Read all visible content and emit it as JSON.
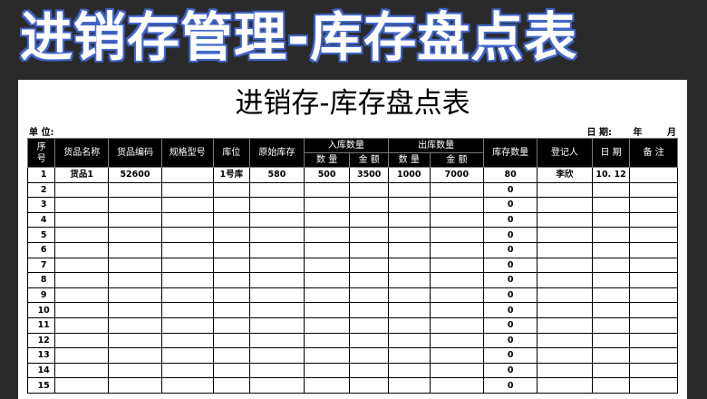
{
  "banner": {
    "title": "进销存管理-库存盘点表"
  },
  "sheet": {
    "title": "进销存-库存盘点表",
    "unit_label": "单 位:",
    "date_label": "日 期:",
    "year_label": "年",
    "month_label": "月"
  },
  "columns": {
    "seq": "序号",
    "name": "货品名称",
    "code": "货品编码",
    "spec": "规格型号",
    "location": "库位",
    "initial": "原始库存",
    "in_group": "入库数量",
    "in_qty": "数 量",
    "in_amount": "金 额",
    "out_group": "出库数量",
    "out_qty": "数 量",
    "out_amount": "金 额",
    "stock": "库存数量",
    "recorder": "登记人",
    "date": "日 期",
    "remark": "备 注"
  },
  "rows": [
    {
      "seq": "1",
      "name": "货品1",
      "code": "52600",
      "spec": "",
      "location": "1号库",
      "initial": "580",
      "in_qty": "500",
      "in_amount": "3500",
      "out_qty": "1000",
      "out_amount": "7000",
      "stock": "80",
      "recorder": "李欣",
      "date": "10. 12",
      "remark": ""
    },
    {
      "seq": "2",
      "name": "",
      "code": "",
      "spec": "",
      "location": "",
      "initial": "",
      "in_qty": "",
      "in_amount": "",
      "out_qty": "",
      "out_amount": "",
      "stock": "0",
      "recorder": "",
      "date": "",
      "remark": ""
    },
    {
      "seq": "3",
      "name": "",
      "code": "",
      "spec": "",
      "location": "",
      "initial": "",
      "in_qty": "",
      "in_amount": "",
      "out_qty": "",
      "out_amount": "",
      "stock": "0",
      "recorder": "",
      "date": "",
      "remark": ""
    },
    {
      "seq": "4",
      "name": "",
      "code": "",
      "spec": "",
      "location": "",
      "initial": "",
      "in_qty": "",
      "in_amount": "",
      "out_qty": "",
      "out_amount": "",
      "stock": "0",
      "recorder": "",
      "date": "",
      "remark": ""
    },
    {
      "seq": "5",
      "name": "",
      "code": "",
      "spec": "",
      "location": "",
      "initial": "",
      "in_qty": "",
      "in_amount": "",
      "out_qty": "",
      "out_amount": "",
      "stock": "0",
      "recorder": "",
      "date": "",
      "remark": ""
    },
    {
      "seq": "6",
      "name": "",
      "code": "",
      "spec": "",
      "location": "",
      "initial": "",
      "in_qty": "",
      "in_amount": "",
      "out_qty": "",
      "out_amount": "",
      "stock": "0",
      "recorder": "",
      "date": "",
      "remark": ""
    },
    {
      "seq": "7",
      "name": "",
      "code": "",
      "spec": "",
      "location": "",
      "initial": "",
      "in_qty": "",
      "in_amount": "",
      "out_qty": "",
      "out_amount": "",
      "stock": "0",
      "recorder": "",
      "date": "",
      "remark": ""
    },
    {
      "seq": "8",
      "name": "",
      "code": "",
      "spec": "",
      "location": "",
      "initial": "",
      "in_qty": "",
      "in_amount": "",
      "out_qty": "",
      "out_amount": "",
      "stock": "0",
      "recorder": "",
      "date": "",
      "remark": ""
    },
    {
      "seq": "9",
      "name": "",
      "code": "",
      "spec": "",
      "location": "",
      "initial": "",
      "in_qty": "",
      "in_amount": "",
      "out_qty": "",
      "out_amount": "",
      "stock": "0",
      "recorder": "",
      "date": "",
      "remark": ""
    },
    {
      "seq": "10",
      "name": "",
      "code": "",
      "spec": "",
      "location": "",
      "initial": "",
      "in_qty": "",
      "in_amount": "",
      "out_qty": "",
      "out_amount": "",
      "stock": "0",
      "recorder": "",
      "date": "",
      "remark": ""
    },
    {
      "seq": "11",
      "name": "",
      "code": "",
      "spec": "",
      "location": "",
      "initial": "",
      "in_qty": "",
      "in_amount": "",
      "out_qty": "",
      "out_amount": "",
      "stock": "0",
      "recorder": "",
      "date": "",
      "remark": ""
    },
    {
      "seq": "12",
      "name": "",
      "code": "",
      "spec": "",
      "location": "",
      "initial": "",
      "in_qty": "",
      "in_amount": "",
      "out_qty": "",
      "out_amount": "",
      "stock": "0",
      "recorder": "",
      "date": "",
      "remark": ""
    },
    {
      "seq": "13",
      "name": "",
      "code": "",
      "spec": "",
      "location": "",
      "initial": "",
      "in_qty": "",
      "in_amount": "",
      "out_qty": "",
      "out_amount": "",
      "stock": "0",
      "recorder": "",
      "date": "",
      "remark": ""
    },
    {
      "seq": "14",
      "name": "",
      "code": "",
      "spec": "",
      "location": "",
      "initial": "",
      "in_qty": "",
      "in_amount": "",
      "out_qty": "",
      "out_amount": "",
      "stock": "0",
      "recorder": "",
      "date": "",
      "remark": ""
    },
    {
      "seq": "15",
      "name": "",
      "code": "",
      "spec": "",
      "location": "",
      "initial": "",
      "in_qty": "",
      "in_amount": "",
      "out_qty": "",
      "out_amount": "",
      "stock": "0",
      "recorder": "",
      "date": "",
      "remark": ""
    }
  ],
  "colors": {
    "background": "#2a2a2a",
    "title_outline": "#3f62c4",
    "header_bg": "#000000"
  }
}
